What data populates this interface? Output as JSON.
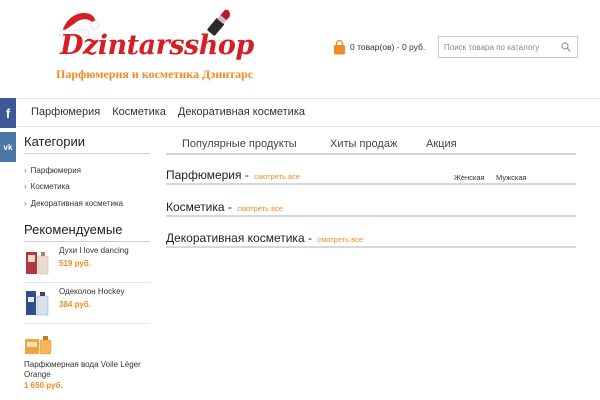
{
  "brand": {
    "logo_text": "Dzintarsshop",
    "tagline": "Парфюмерия и косметика Дзинтарс",
    "color": "#d61f25",
    "accent": "#f28b23"
  },
  "cart": {
    "text": "0 товар(ов) - 0 руб."
  },
  "search": {
    "placeholder": "Поиск товара по каталогу"
  },
  "nav": {
    "items": [
      "Парфюмерия",
      "Косметика",
      "Декоративная косметика"
    ]
  },
  "social": {
    "facebook": "f",
    "vk": "vk"
  },
  "sidebar": {
    "categories_heading": "Категории",
    "categories": [
      "Парфюмерия",
      "Косметика",
      "Декоративная косметика"
    ],
    "recommended_heading": "Рекомендуемые",
    "recommended": [
      {
        "name": "Духи I love dancing",
        "price": "519 руб."
      },
      {
        "name": "Одеколон Hockey",
        "price": "384 руб."
      },
      {
        "name": "Парфюмерная вода Voile Léger Orange",
        "price": "1 650 руб."
      }
    ]
  },
  "tabs": [
    "Популярные продукты",
    "Хиты продаж",
    "Акция"
  ],
  "sections": [
    {
      "title": "Парфюмерия",
      "link": "смотреть все"
    },
    {
      "title": "Косметика",
      "link": "смотреть все"
    },
    {
      "title": "Декоративная косметика",
      "link": "смотреть все"
    }
  ],
  "filters": [
    "Женская",
    "Мужская"
  ]
}
